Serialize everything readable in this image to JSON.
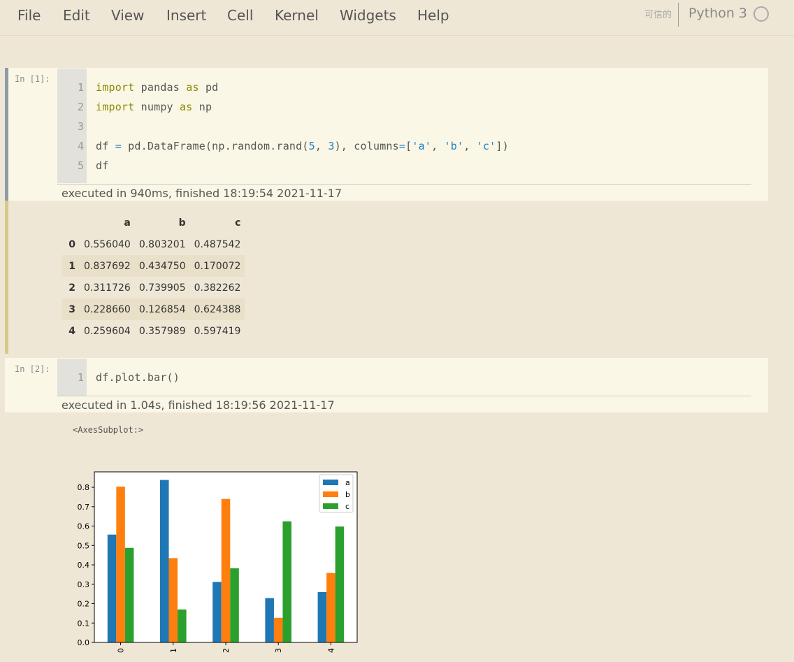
{
  "menubar": {
    "items": [
      "File",
      "Edit",
      "View",
      "Insert",
      "Cell",
      "Kernel",
      "Widgets",
      "Help"
    ],
    "trusted_label": "可信的",
    "kernel_name": "Python 3"
  },
  "cell1": {
    "prompt": "In  [1]:",
    "line_numbers": [
      "1",
      "2",
      "3",
      "4",
      "5"
    ],
    "exec_info": "executed in 940ms, finished 18:19:54 2021-11-17"
  },
  "dataframe": {
    "columns": [
      "a",
      "b",
      "c"
    ],
    "rows": [
      {
        "index": "0",
        "a": "0.556040",
        "b": "0.803201",
        "c": "0.487542"
      },
      {
        "index": "1",
        "a": "0.837692",
        "b": "0.434750",
        "c": "0.170072"
      },
      {
        "index": "2",
        "a": "0.311726",
        "b": "0.739905",
        "c": "0.382262"
      },
      {
        "index": "3",
        "a": "0.228660",
        "b": "0.126854",
        "c": "0.624388"
      },
      {
        "index": "4",
        "a": "0.259604",
        "b": "0.357989",
        "c": "0.597419"
      }
    ]
  },
  "cell2": {
    "prompt": "In  [2]:",
    "line_numbers": [
      "1"
    ],
    "code": "df.plot.bar()",
    "exec_info": "executed in 1.04s, finished 18:19:56 2021-11-17",
    "output_text": "<AxesSubplot:>"
  },
  "chart_data": {
    "type": "bar",
    "categories": [
      "0",
      "1",
      "2",
      "3",
      "4"
    ],
    "series": [
      {
        "name": "a",
        "color": "#1f77b4",
        "values": [
          0.55604,
          0.837692,
          0.311726,
          0.22866,
          0.259604
        ]
      },
      {
        "name": "b",
        "color": "#ff7f0e",
        "values": [
          0.803201,
          0.43475,
          0.739905,
          0.126854,
          0.357989
        ]
      },
      {
        "name": "c",
        "color": "#2ca02c",
        "values": [
          0.487542,
          0.170072,
          0.382262,
          0.624388,
          0.597419
        ]
      }
    ],
    "yticks": [
      "0.0",
      "0.1",
      "0.2",
      "0.3",
      "0.4",
      "0.5",
      "0.6",
      "0.7",
      "0.8"
    ],
    "ylim": [
      0,
      0.8795
    ],
    "legend_position": "upper right",
    "grid": false
  }
}
